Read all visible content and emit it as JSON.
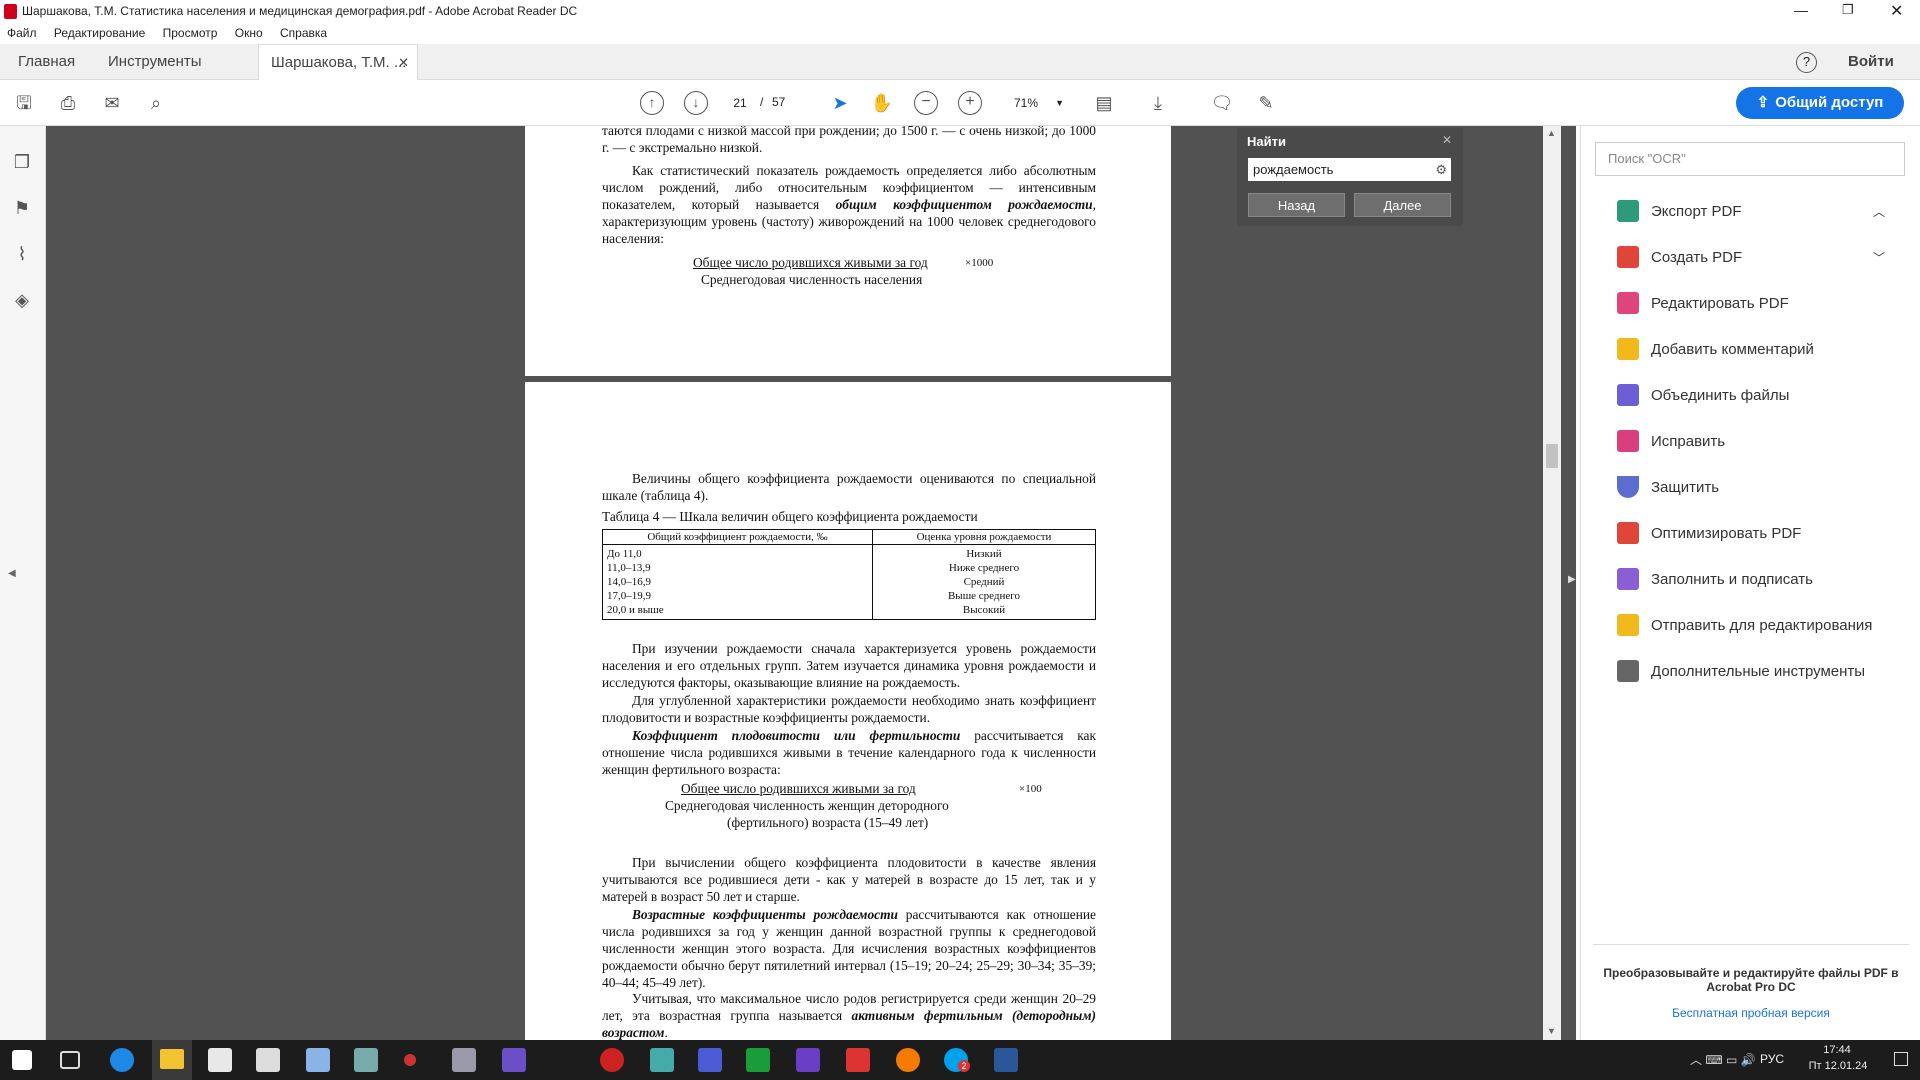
{
  "window": {
    "title": "Шаршакова, Т.М. Статистика населения и медицинская демография.pdf - Adobe Acrobat Reader DC"
  },
  "menu": [
    "Файл",
    "Редактирование",
    "Просмотр",
    "Окно",
    "Справка"
  ],
  "tabs": {
    "home": "Главная",
    "tools": "Инструменты",
    "doc": "Шаршакова, Т.М. ...",
    "help": "?",
    "login": "Войти"
  },
  "toolbar": {
    "page_current": "21",
    "page_sep": "/",
    "page_total": "57",
    "zoom": "71%",
    "share": "Общий доступ"
  },
  "find": {
    "title": "Найти",
    "query": "рождаемость",
    "back": "Назад",
    "next": "Далее"
  },
  "page1": {
    "p1": "таются плодами с низкой массой при рождении; до 1500 г. — с очень низкой; до 1000 г. — с экстремально низкой.",
    "p2a": "Как статистический показатель рождаемость определяется либо абсолютным числом рождений, либо относительным коэффициентом — интенсивным показателем, который называется ",
    "p2b": "общим коэффициентом рождаемости",
    "p2c": ", характеризующим уровень (частоту) живорождений на 1000 человек среднегодового населения:",
    "f_num": "Общее число родившихся живыми за год",
    "f_mult": "×1000",
    "f_den": "Среднегодовая численность населения"
  },
  "page2": {
    "p1": "Величины общего коэффициента рождаемости оцениваются по специальной шкале (таблица 4).",
    "caption": "Таблица 4 — Шкала величин общего коэффициента рождаемости",
    "table": {
      "headers": [
        "Общий коэффициент рождаемости, ‰",
        "Оценка уровня рождаемости"
      ],
      "rows": [
        [
          "До 11,0",
          "Низкий"
        ],
        [
          "11,0–13,9",
          "Ниже среднего"
        ],
        [
          "14,0–16,9",
          "Средний"
        ],
        [
          "17,0–19,9",
          "Выше среднего"
        ],
        [
          "20,0 и выше",
          "Высокий"
        ]
      ]
    },
    "p2": "При изучении рождаемости сначала характеризуется уровень рождаемости населения и его отдельных групп. Затем изучается динамика уровня рождаемости и исследуются факторы, оказывающие влияние на рождаемость.",
    "p3": "Для углубленной характеристики рождаемости необходимо знать коэффициент плодовитости и возрастные коэффициенты рождаемости.",
    "p4a": "Коэффициент плодовитости или фертильности",
    "p4b": " рассчитывается как отношение числа родившихся живыми в течение календарного года к численности женщин фертильного возраста:",
    "f_num": "Общее число родившихся живыми за год",
    "f_mult": "×100",
    "f_den1": "Среднегодовая численность женщин детородного",
    "f_den2": "(фертильного) возраста (15–49 лет)",
    "p5": "При вычислении общего коэффициента плодовитости в качестве явления учитываются все родившиеся дети - как у матерей в возрасте до 15 лет, так и у матерей в возраст 50 лет и старше.",
    "p6a": "Возрастные коэффициенты рождаемости",
    "p6b": " рассчитываются как отношение числа родившихся за год у женщин данной возрастной группы к среднегодовой численности женщин этого возраста. Для исчисления возрастных коэффициентов рождаемости обычно берут пятилетний интервал (15–19; 20–24; 25–29; 30–34; 35–39; 40–44; 45–49 лет).",
    "p7a": "Учитывая, что максимальное число родов регистрируется среди женщин 20–29 лет, эта возрастная группа называется ",
    "p7b": "активным фертильным (детородным) возрастом",
    "p7c": "."
  },
  "right": {
    "search_placeholder": "Поиск \"OCR\"",
    "tools": [
      "Экспорт PDF",
      "Создать PDF",
      "Редактировать PDF",
      "Добавить комментарий",
      "Объединить файлы",
      "Исправить",
      "Защитить",
      "Оптимизировать PDF",
      "Заполнить и подписать",
      "Отправить для редактирования",
      "Дополнительные инструменты"
    ],
    "promo": "Преобразовывайте и редактируйте файлы PDF в Acrobat Pro DC",
    "trial": "Бесплатная пробная версия"
  },
  "taskbar": {
    "lang": "РУС",
    "time": "17:44",
    "date": "Пт 12.01.24",
    "skype_badge": "2"
  },
  "colors": {
    "accent": "#1473e6",
    "viewer_bg": "#525252",
    "taskbar": "#1c1c1c"
  }
}
